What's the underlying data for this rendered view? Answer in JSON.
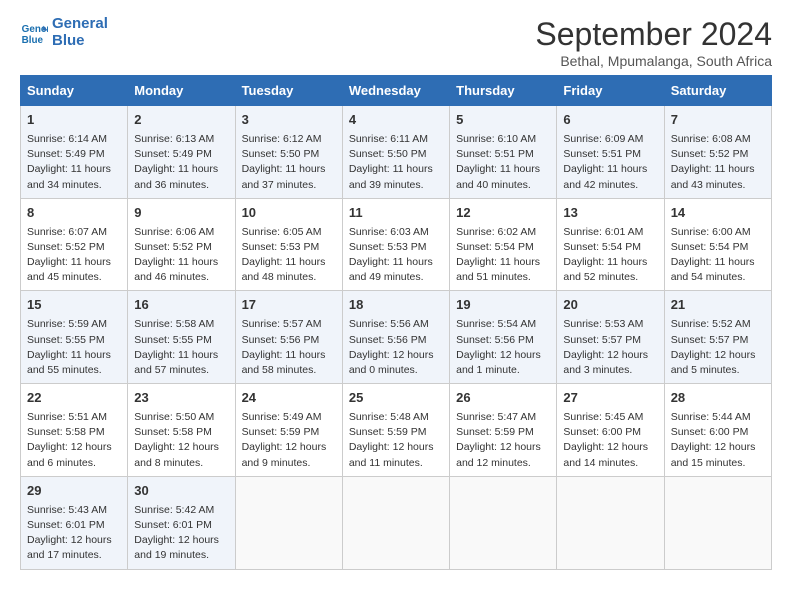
{
  "header": {
    "logo_line1": "General",
    "logo_line2": "Blue",
    "month": "September 2024",
    "location": "Bethal, Mpumalanga, South Africa"
  },
  "days_of_week": [
    "Sunday",
    "Monday",
    "Tuesday",
    "Wednesday",
    "Thursday",
    "Friday",
    "Saturday"
  ],
  "weeks": [
    [
      {
        "day": 1,
        "sunrise": "6:14 AM",
        "sunset": "5:49 PM",
        "daylight": "11 hours and 34 minutes."
      },
      {
        "day": 2,
        "sunrise": "6:13 AM",
        "sunset": "5:49 PM",
        "daylight": "11 hours and 36 minutes."
      },
      {
        "day": 3,
        "sunrise": "6:12 AM",
        "sunset": "5:50 PM",
        "daylight": "11 hours and 37 minutes."
      },
      {
        "day": 4,
        "sunrise": "6:11 AM",
        "sunset": "5:50 PM",
        "daylight": "11 hours and 39 minutes."
      },
      {
        "day": 5,
        "sunrise": "6:10 AM",
        "sunset": "5:51 PM",
        "daylight": "11 hours and 40 minutes."
      },
      {
        "day": 6,
        "sunrise": "6:09 AM",
        "sunset": "5:51 PM",
        "daylight": "11 hours and 42 minutes."
      },
      {
        "day": 7,
        "sunrise": "6:08 AM",
        "sunset": "5:52 PM",
        "daylight": "11 hours and 43 minutes."
      }
    ],
    [
      {
        "day": 8,
        "sunrise": "6:07 AM",
        "sunset": "5:52 PM",
        "daylight": "11 hours and 45 minutes."
      },
      {
        "day": 9,
        "sunrise": "6:06 AM",
        "sunset": "5:52 PM",
        "daylight": "11 hours and 46 minutes."
      },
      {
        "day": 10,
        "sunrise": "6:05 AM",
        "sunset": "5:53 PM",
        "daylight": "11 hours and 48 minutes."
      },
      {
        "day": 11,
        "sunrise": "6:03 AM",
        "sunset": "5:53 PM",
        "daylight": "11 hours and 49 minutes."
      },
      {
        "day": 12,
        "sunrise": "6:02 AM",
        "sunset": "5:54 PM",
        "daylight": "11 hours and 51 minutes."
      },
      {
        "day": 13,
        "sunrise": "6:01 AM",
        "sunset": "5:54 PM",
        "daylight": "11 hours and 52 minutes."
      },
      {
        "day": 14,
        "sunrise": "6:00 AM",
        "sunset": "5:54 PM",
        "daylight": "11 hours and 54 minutes."
      }
    ],
    [
      {
        "day": 15,
        "sunrise": "5:59 AM",
        "sunset": "5:55 PM",
        "daylight": "11 hours and 55 minutes."
      },
      {
        "day": 16,
        "sunrise": "5:58 AM",
        "sunset": "5:55 PM",
        "daylight": "11 hours and 57 minutes."
      },
      {
        "day": 17,
        "sunrise": "5:57 AM",
        "sunset": "5:56 PM",
        "daylight": "11 hours and 58 minutes."
      },
      {
        "day": 18,
        "sunrise": "5:56 AM",
        "sunset": "5:56 PM",
        "daylight": "12 hours and 0 minutes."
      },
      {
        "day": 19,
        "sunrise": "5:54 AM",
        "sunset": "5:56 PM",
        "daylight": "12 hours and 1 minute."
      },
      {
        "day": 20,
        "sunrise": "5:53 AM",
        "sunset": "5:57 PM",
        "daylight": "12 hours and 3 minutes."
      },
      {
        "day": 21,
        "sunrise": "5:52 AM",
        "sunset": "5:57 PM",
        "daylight": "12 hours and 5 minutes."
      }
    ],
    [
      {
        "day": 22,
        "sunrise": "5:51 AM",
        "sunset": "5:58 PM",
        "daylight": "12 hours and 6 minutes."
      },
      {
        "day": 23,
        "sunrise": "5:50 AM",
        "sunset": "5:58 PM",
        "daylight": "12 hours and 8 minutes."
      },
      {
        "day": 24,
        "sunrise": "5:49 AM",
        "sunset": "5:59 PM",
        "daylight": "12 hours and 9 minutes."
      },
      {
        "day": 25,
        "sunrise": "5:48 AM",
        "sunset": "5:59 PM",
        "daylight": "12 hours and 11 minutes."
      },
      {
        "day": 26,
        "sunrise": "5:47 AM",
        "sunset": "5:59 PM",
        "daylight": "12 hours and 12 minutes."
      },
      {
        "day": 27,
        "sunrise": "5:45 AM",
        "sunset": "6:00 PM",
        "daylight": "12 hours and 14 minutes."
      },
      {
        "day": 28,
        "sunrise": "5:44 AM",
        "sunset": "6:00 PM",
        "daylight": "12 hours and 15 minutes."
      }
    ],
    [
      {
        "day": 29,
        "sunrise": "5:43 AM",
        "sunset": "6:01 PM",
        "daylight": "12 hours and 17 minutes."
      },
      {
        "day": 30,
        "sunrise": "5:42 AM",
        "sunset": "6:01 PM",
        "daylight": "12 hours and 19 minutes."
      },
      null,
      null,
      null,
      null,
      null
    ]
  ]
}
